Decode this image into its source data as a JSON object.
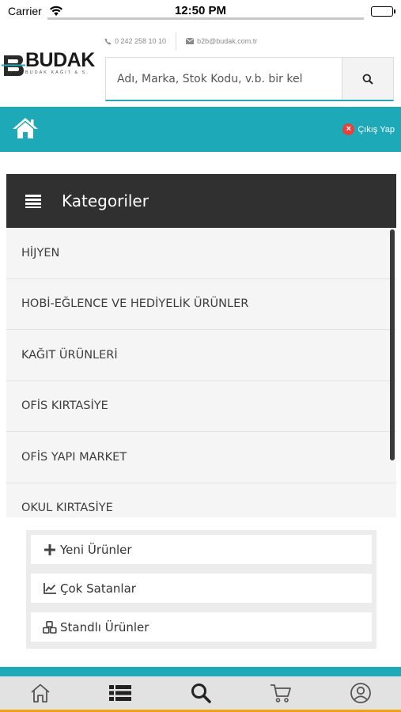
{
  "status_bar": {
    "carrier": "Carrier",
    "time": "12:50 PM"
  },
  "contacts": {
    "phone": "0 242 258 10 10",
    "email": "b2b@budak.com.tr"
  },
  "logo": {
    "name": "BUDAK",
    "subtitle": "BUDAK KAĞIT & S."
  },
  "search": {
    "placeholder": "Adı, Marka, Stok Kodu, v.b. bir kel"
  },
  "top_bar": {
    "logout_label": "Çıkış Yap"
  },
  "categories": {
    "title": "Kategoriler",
    "items": [
      {
        "label": "HİJYEN"
      },
      {
        "label": "HOBİ-EĞLENCE VE HEDİYELİK ÜRÜNLER"
      },
      {
        "label": "KAĞIT ÜRÜNLERİ"
      },
      {
        "label": "OFİS KIRTASİYE"
      },
      {
        "label": "OFİS YAPI MARKET"
      },
      {
        "label": "OKUL KIRTASİYE"
      }
    ]
  },
  "quick_links": [
    {
      "label": "Yeni Ürünler",
      "icon": "plus-icon"
    },
    {
      "label": "Çok Satanlar",
      "icon": "line-chart-icon"
    },
    {
      "label": "Standlı Ürünler",
      "icon": "cubes-icon"
    }
  ],
  "tab_bar": {
    "tabs": [
      {
        "icon": "home-icon"
      },
      {
        "icon": "list-icon"
      },
      {
        "icon": "search-icon"
      },
      {
        "icon": "cart-icon"
      },
      {
        "icon": "user-icon"
      }
    ]
  },
  "colors": {
    "accent": "#1ea9b8",
    "header_dark": "#303030",
    "tab_underline": "#f0a31a",
    "logout_red": "#e8413b"
  }
}
